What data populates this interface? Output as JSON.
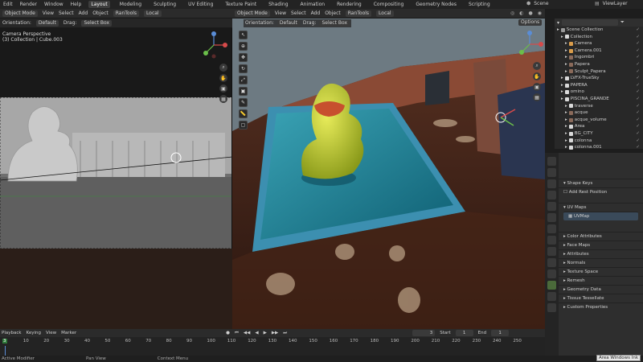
{
  "topbar": {
    "menus": [
      "Edit",
      "Render",
      "Window",
      "Help"
    ],
    "tabs": [
      "Layout",
      "Modeling",
      "Sculpting",
      "UV Editing",
      "Texture Paint",
      "Shading",
      "Animation",
      "Rendering",
      "Compositing",
      "Geometry Nodes",
      "Scripting"
    ],
    "active_tab": "Layout",
    "scene_label": "Scene",
    "viewlayer_label": "ViewLayer"
  },
  "left_header": {
    "mode": "Object Mode",
    "menus": [
      "View",
      "Select",
      "Add",
      "Object"
    ],
    "addon": "RanTools",
    "transform": "Local"
  },
  "left_subheader": {
    "orientation_label": "Orientation:",
    "orientation_value": "Default",
    "drag_label": "Drag:",
    "select_box": "Select Box"
  },
  "left_viewport": {
    "title": "Camera Perspective",
    "subtitle": "(3) Collection | Cube.003"
  },
  "right_header": {
    "mode": "Object Mode",
    "menus": [
      "View",
      "Select",
      "Add",
      "Object"
    ],
    "addon": "RanTools",
    "transform": "Local"
  },
  "right_subheader": {
    "orientation_label": "Orientation:",
    "orientation_value": "Default",
    "drag_label": "Drag:",
    "select_box": "Select Box",
    "options": "Options"
  },
  "outliner": {
    "items": [
      {
        "label": "Scene Collection",
        "indent": 0,
        "color": "#9a9a9a"
      },
      {
        "label": "Collection",
        "indent": 1,
        "color": "#d9d9d9"
      },
      {
        "label": "Camera",
        "indent": 2,
        "color": "#d99c4b"
      },
      {
        "label": "Camera.001",
        "indent": 2,
        "color": "#d99c4b"
      },
      {
        "label": "Ingombri",
        "indent": 2,
        "color": "#8a6a5a"
      },
      {
        "label": "Papera",
        "indent": 2,
        "color": "#8a6a5a"
      },
      {
        "label": "Sculpt_Papera",
        "indent": 2,
        "color": "#8a6a5a"
      },
      {
        "label": "LVFX-TrueSky",
        "indent": 1,
        "color": "#d9d9d9"
      },
      {
        "label": "PAPERA",
        "indent": 1,
        "color": "#d9d9d9"
      },
      {
        "label": "omino",
        "indent": 1,
        "color": "#d9d9d9"
      },
      {
        "label": "PISCINA_GRANDE",
        "indent": 1,
        "color": "#d9d9d9"
      },
      {
        "label": "traverse",
        "indent": 2,
        "color": "#d9d9d9"
      },
      {
        "label": "acque",
        "indent": 2,
        "color": "#8a6a5a"
      },
      {
        "label": "acque_volume",
        "indent": 2,
        "color": "#8a6a5a"
      },
      {
        "label": "Area",
        "indent": 2,
        "color": "#d9d9d9"
      },
      {
        "label": "BG_CITY",
        "indent": 2,
        "color": "#d9d9d9"
      },
      {
        "label": "colonna",
        "indent": 2,
        "color": "#d9d9d9"
      },
      {
        "label": "colonna.001",
        "indent": 2,
        "color": "#d9d9d9"
      }
    ]
  },
  "properties": {
    "sections": [
      {
        "label": "Shape Keys",
        "expanded": true
      },
      {
        "label": "Add Rest Position",
        "checkbox": true
      },
      {
        "label": "UV Maps",
        "expanded": true
      },
      {
        "label": "UVMap",
        "is_entry": true
      },
      {
        "label": "Color Attributes"
      },
      {
        "label": "Face Maps"
      },
      {
        "label": "Attributes"
      },
      {
        "label": "Normals"
      },
      {
        "label": "Texture Space"
      },
      {
        "label": "Remesh"
      },
      {
        "label": "Geometry Data"
      },
      {
        "label": "Tissue Tessellate"
      },
      {
        "label": "Custom Properties"
      }
    ]
  },
  "timeline": {
    "menus": [
      "Playback",
      "Keying",
      "View",
      "Marker"
    ],
    "current_frame": "3",
    "start_label": "Start",
    "start_value": "1",
    "end_label": "End",
    "end_value": "1",
    "ruler_marks": [
      "3",
      "10",
      "20",
      "30",
      "40",
      "50",
      "60",
      "70",
      "80",
      "90",
      "100",
      "110",
      "120",
      "130",
      "140",
      "150",
      "160",
      "170",
      "180",
      "190",
      "200",
      "210",
      "220",
      "230",
      "240",
      "250"
    ]
  },
  "statusbar": {
    "items": [
      "Active Modifier",
      "Pan View",
      "Context Menu"
    ],
    "tooltip": "Area Windows Ink"
  },
  "colors": {
    "accent": "#4772b3",
    "timeline_playhead": "#5a8dd6",
    "frame_marker": "#2f7a3a"
  }
}
